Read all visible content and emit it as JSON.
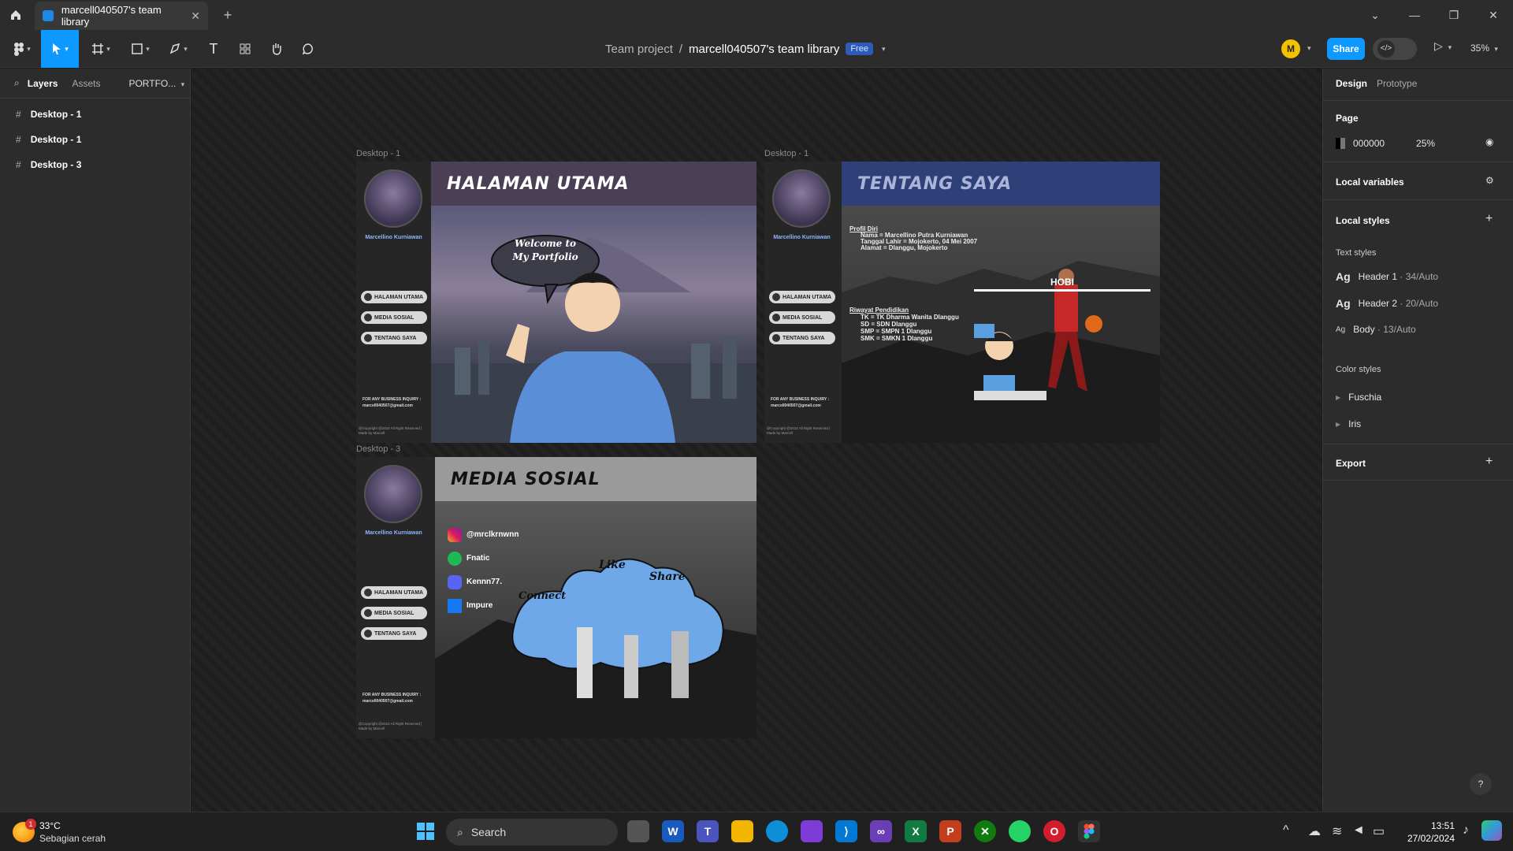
{
  "app": {
    "tab_title": "marcell040507's team library",
    "new_tab": "+"
  },
  "toolbar": {
    "project": "Team project",
    "separator": "/",
    "file_name": "marcell040507's team library",
    "plan_badge": "Free",
    "avatar_initial": "M",
    "share_label": "Share",
    "zoom": "35%"
  },
  "left_panel": {
    "tabs": [
      "Layers",
      "Assets"
    ],
    "page_select": "PORTFO...",
    "layers": [
      "Desktop - 1",
      "Desktop - 1",
      "Desktop - 3"
    ]
  },
  "canvas": {
    "frames": [
      {
        "label": "Desktop - 1",
        "header": "HALAMAN UTAMA",
        "header_color": "#4a3f55",
        "speech": [
          "Welcome to",
          "My Portfolio"
        ]
      },
      {
        "label": "Desktop - 1",
        "header": "TENTANG SAYA",
        "header_color": "#2f3f78",
        "profil_title": "Profil Diri",
        "profil": [
          "Nama = Marcellino Putra Kurniawan",
          "Tanggal Lahir = Mojokerto, 04 Mei 2007",
          "Alamat = Dlanggu, Mojokerto"
        ],
        "hobi": "HOBI",
        "pendidikan_title": "Riwayat Pendidikan",
        "pendidikan": [
          "TK = TK Dharma Wanita Dlanggu",
          "SD = SDN Dlanggu",
          "SMP = SMPN 1 Dlanggu",
          "SMK = SMKN 1 Dlanggu"
        ]
      },
      {
        "label": "Desktop - 3",
        "header": "MEDIA SOSIAL",
        "header_color": "#9a9a9a",
        "socials": [
          "@mrclkrnwnn",
          "Fnatic",
          "Kennn77.",
          "Impure"
        ],
        "art_words": [
          "Like",
          "Share",
          "Connect"
        ]
      }
    ],
    "sidebar": {
      "name": "Marcellino Kurniawan",
      "nav": [
        "HALAMAN UTAMA",
        "MEDIA SOSIAL",
        "TENTANG SAYA"
      ],
      "inquiry": "FOR ANY BUSINESS INQUIRY :",
      "email": "marcell040507@gmail.com",
      "copyright": "@Copyright @2024 All Right Reserved | Made by Marcell"
    }
  },
  "right_panel": {
    "tabs": [
      "Design",
      "Prototype"
    ],
    "page_title": "Page",
    "page_color": "000000",
    "page_opacity": "25%",
    "local_variables": "Local variables",
    "local_styles": "Local styles",
    "text_styles_title": "Text styles",
    "text_styles": [
      {
        "name": "Header 1",
        "spec": " · 34/Auto"
      },
      {
        "name": "Header 2",
        "spec": " · 20/Auto"
      },
      {
        "name": "Body",
        "spec": " · 13/Auto"
      }
    ],
    "color_styles_title": "Color styles",
    "color_styles": [
      "Fuschia",
      "Iris"
    ],
    "export": "Export",
    "help": "?"
  },
  "taskbar": {
    "weather_temp": "33°C",
    "weather_desc": "Sebagian cerah",
    "weather_badge": "1",
    "search": "Search",
    "time": "13:51",
    "date": "27/02/2024"
  },
  "colors": {
    "accent": "#0d99ff",
    "badge": "#2f5bb8"
  }
}
